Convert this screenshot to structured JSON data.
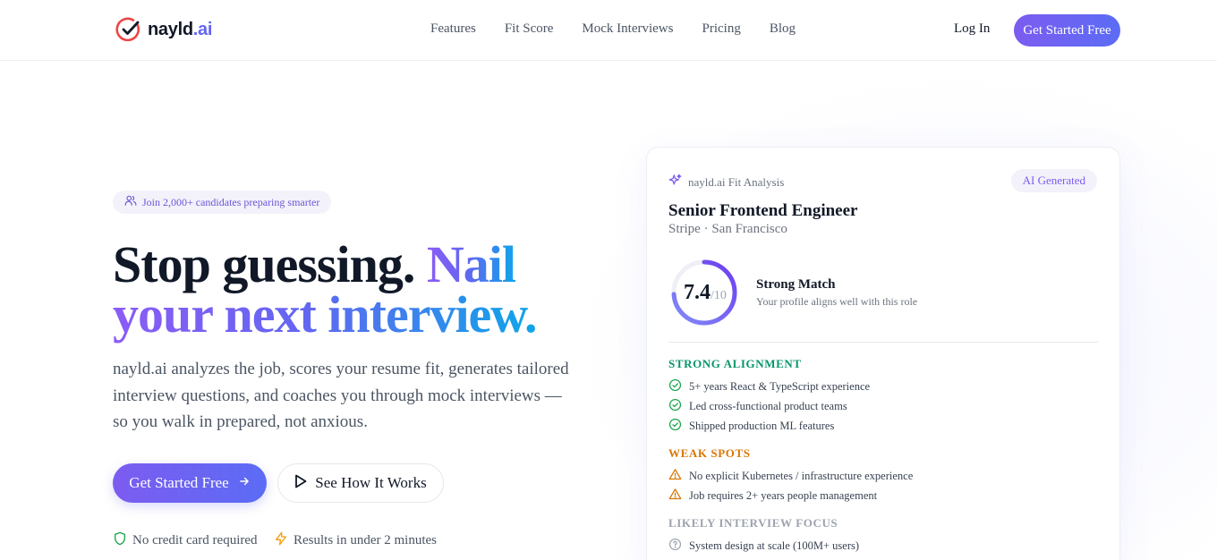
{
  "brand": {
    "name": "nayld",
    "suffix": ".ai"
  },
  "nav": {
    "links": [
      "Features",
      "Fit Score",
      "Mock Interviews",
      "Pricing",
      "Blog"
    ],
    "login": "Log In",
    "cta": "Get Started Free"
  },
  "hero": {
    "pill": "Join 2,000+ candidates preparing smarter",
    "headline_dark": "Stop guessing.",
    "headline_accent_1": "Nail",
    "headline_accent_2": "your next interview.",
    "subtitle": "nayld.ai analyzes the job, scores your resume fit, generates tailored interview questions, and coaches you through mock interviews — so you walk in prepared, not anxious.",
    "primary_cta": "Get Started Free",
    "secondary_cta": "See How It Works",
    "trust": [
      "No credit card required",
      "Results in under 2 minutes"
    ]
  },
  "card": {
    "header": "nayld.ai Fit Analysis",
    "badge": "AI Generated",
    "job_title": "Senior Frontend Engineer",
    "job_company": "Stripe · San Francisco",
    "score": "7.4",
    "score_max": "/10",
    "score_fraction": 0.74,
    "match_title": "Strong Match",
    "match_desc": "Your profile aligns well with this role",
    "strong": {
      "title": "STRONG ALIGNMENT",
      "items": [
        "5+ years React & TypeScript experience",
        "Led cross-functional product teams",
        "Shipped production ML features"
      ]
    },
    "weak": {
      "title": "WEAK SPOTS",
      "items": [
        "No explicit Kubernetes / infrastructure experience",
        "Job requires 2+ years people management"
      ]
    },
    "focus": {
      "title": "LIKELY INTERVIEW FOCUS",
      "items": [
        "System design at scale (100M+ users)"
      ]
    }
  },
  "colors": {
    "accent": "#6366f1",
    "accent_purple": "#7c5cf0",
    "success": "#16a34a",
    "warning": "#d97706",
    "muted": "#9ca3af"
  }
}
